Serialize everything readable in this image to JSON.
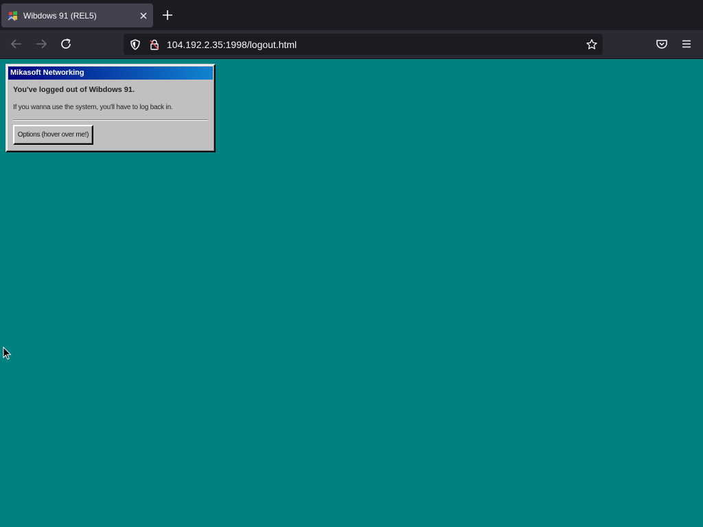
{
  "browser": {
    "tab": {
      "title": "Wibdows 91 (REL5)",
      "favicon": "wibdows-logo-icon"
    },
    "new_tab_icon": "plus-icon",
    "nav": {
      "back_icon": "arrow-left-icon",
      "forward_icon": "arrow-right-icon",
      "reload_icon": "reload-icon"
    },
    "url": "104.192.2.35:1998/logout.html",
    "url_icons": [
      "shield-icon",
      "insecure-lock-icon"
    ],
    "bookmark_icon": "star-icon",
    "toolbar_icons": [
      "pocket-icon",
      "hamburger-menu-icon"
    ]
  },
  "dialog": {
    "title": "Mikasoft Networking",
    "heading": "You've logged out of Wibdows 91.",
    "message": "If you wanna use the system, you'll have to log back in.",
    "button_label": "Options (hover over me!)"
  },
  "colors": {
    "desktop": "#008080",
    "dialog_face": "#c0c0c0",
    "titlebar_start": "#000080",
    "titlebar_end": "#1084d0",
    "browser_tabstrip": "#1c1b22",
    "browser_toolbar": "#2b2a33"
  }
}
